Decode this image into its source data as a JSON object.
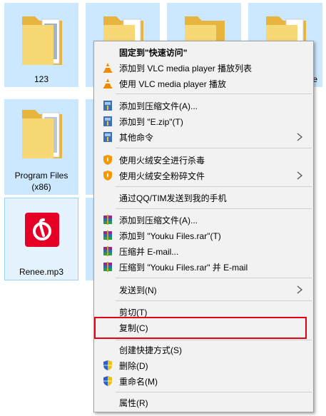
{
  "desktop": {
    "items": [
      {
        "label": "123"
      },
      {
        "label": ""
      },
      {
        "label": ""
      },
      {
        "label": "ge"
      },
      {
        "label": "Program Files (x86)"
      },
      {
        "label": "Renee.mp3"
      }
    ]
  },
  "context_menu": {
    "items": [
      {
        "label": "固定到\"快速访问\"",
        "icon": "none",
        "bold": true
      },
      {
        "label": "添加到 VLC media player 播放列表",
        "icon": "vlc-cone-icon"
      },
      {
        "label": "使用 VLC media player 播放",
        "icon": "vlc-cone-icon"
      },
      {
        "label": "添加到压缩文件(A)...",
        "icon": "archive-icon"
      },
      {
        "label": "添加到 \"E.zip\"(T)",
        "icon": "archive-icon"
      },
      {
        "label": "其他命令",
        "icon": "archive-icon",
        "submenu": true
      },
      {
        "label": "使用火绒安全进行杀毒",
        "icon": "huorong-shield-icon"
      },
      {
        "label": "使用火绒安全粉碎文件",
        "icon": "huorong-shield-icon",
        "submenu": true
      },
      {
        "label": "通过QQ/TIM发送到我的手机",
        "icon": "none"
      },
      {
        "label": "添加到压缩文件(A)...",
        "icon": "winrar-books-icon"
      },
      {
        "label": "添加到 \"Youku Files.rar\"(T)",
        "icon": "winrar-books-icon"
      },
      {
        "label": "压缩并 E-mail...",
        "icon": "winrar-books-icon"
      },
      {
        "label": "压缩到 \"Youku Files.rar\" 并 E-mail",
        "icon": "winrar-books-icon"
      },
      {
        "label": "发送到(N)",
        "icon": "none",
        "submenu": true
      },
      {
        "label": "剪切(T)",
        "icon": "none"
      },
      {
        "label": "复制(C)",
        "icon": "none"
      },
      {
        "label": "创建快捷方式(S)",
        "icon": "none"
      },
      {
        "label": "删除(D)",
        "icon": "uac-shield-icon"
      },
      {
        "label": "重命名(M)",
        "icon": "uac-shield-icon"
      },
      {
        "label": "属性(R)",
        "icon": "none"
      }
    ]
  },
  "colors": {
    "selection": "#cce8ff",
    "menu_bg": "#f2f2f2",
    "highlight_box": "#e60012",
    "folder": "#f8d775",
    "netease_red": "#e60026"
  }
}
